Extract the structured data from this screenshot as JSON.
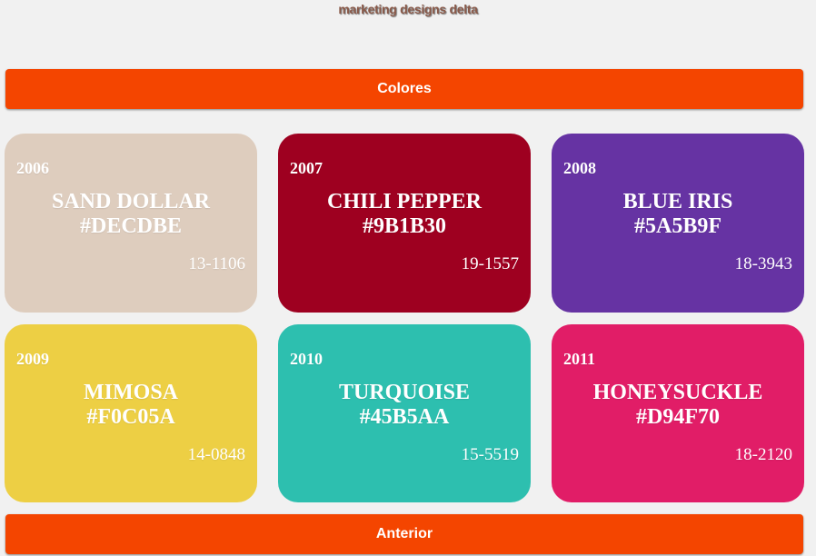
{
  "header": {
    "logo_text": "marketing designs delta"
  },
  "nav": {
    "colores_label": "Colores",
    "anterior_label": "Anterior"
  },
  "colors": [
    {
      "year": "2006",
      "name": "SAND DOLLAR",
      "hex": "#DECDBE",
      "code": "13-1106",
      "bg": "#DECDBE"
    },
    {
      "year": "2007",
      "name": "CHILI PEPPER",
      "hex": "#9B1B30",
      "code": "19-1557",
      "bg": "#9E0020"
    },
    {
      "year": "2008",
      "name": "BLUE IRIS",
      "hex": "#5A5B9F",
      "code": "18-3943",
      "bg": "#6633A3"
    },
    {
      "year": "2009",
      "name": "MIMOSA",
      "hex": "#F0C05A",
      "code": "14-0848",
      "bg": "#EDCF44"
    },
    {
      "year": "2010",
      "name": "TURQUOISE",
      "hex": "#45B5AA",
      "code": "15-5519",
      "bg": "#2DBFAF"
    },
    {
      "year": "2011",
      "name": "HONEYSUCKLE",
      "hex": "#D94F70",
      "code": "18-2120",
      "bg": "#E11D67"
    }
  ]
}
